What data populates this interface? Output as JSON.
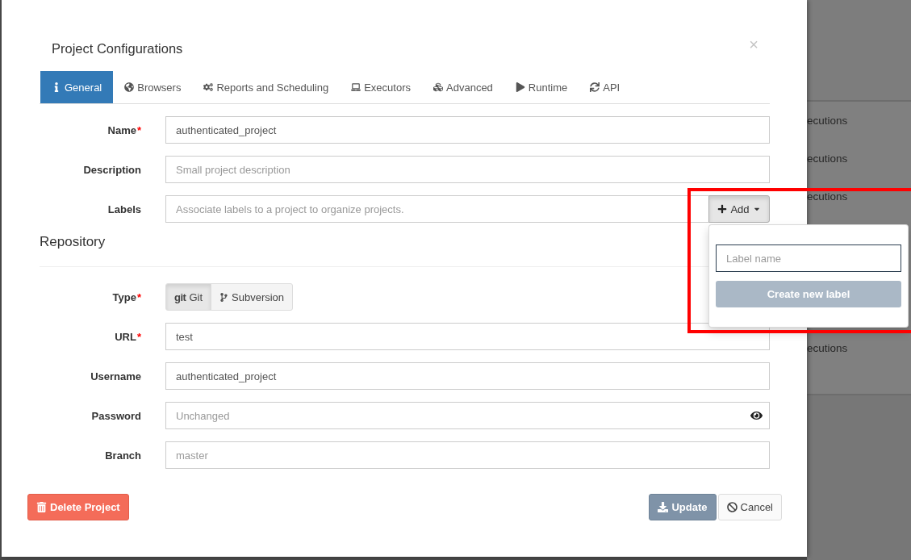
{
  "modal": {
    "title": "Project Configurations",
    "close": "×",
    "tabs": [
      {
        "label": "General",
        "selected": true
      },
      {
        "label": "Browsers",
        "selected": false
      },
      {
        "label": "Reports and Scheduling",
        "selected": false
      },
      {
        "label": "Executors",
        "selected": false
      },
      {
        "label": "Advanced",
        "selected": false
      },
      {
        "label": "Runtime",
        "selected": false
      },
      {
        "label": "API",
        "selected": false
      }
    ],
    "general": {
      "fields": [
        {
          "kind": "text",
          "label": "Name",
          "required_mark": "*",
          "value": "authenticated_project"
        },
        {
          "kind": "text",
          "label": "Description",
          "placeholder": "Small project description"
        },
        {
          "kind": "labels",
          "label": "Labels",
          "placeholder": "Associate labels to a project to organize projects.",
          "add_button": "Add",
          "menu": {
            "open": true,
            "placeholder": "Label name",
            "create_button": "Create new label",
            "create_disabled": true
          }
        }
      ],
      "repository": {
        "heading": "Repository",
        "fields": [
          {
            "kind": "toggle",
            "label": "Type",
            "required_mark": "*",
            "options": [
              {
                "kind": "git",
                "logo": "git",
                "label": "Git",
                "selected": true
              },
              {
                "kind": "subversion",
                "label": "Subversion",
                "selected": false
              }
            ]
          },
          {
            "kind": "text",
            "label": "URL",
            "required_mark": "*",
            "value": "test"
          },
          {
            "kind": "text",
            "label": "Username",
            "value": "authenticated_project"
          },
          {
            "kind": "password",
            "label": "Password",
            "placeholder": "Unchanged"
          },
          {
            "kind": "text",
            "label": "Branch",
            "placeholder": "master"
          }
        ]
      }
    },
    "footer": {
      "delete_button": "Delete Project",
      "update_button": "Update",
      "cancel_button": "Cancel"
    }
  },
  "background": {
    "rows": [
      "ecutions",
      "ecutions",
      "ecutions",
      "ecutions"
    ]
  },
  "highlight": {
    "kind": "frame"
  }
}
